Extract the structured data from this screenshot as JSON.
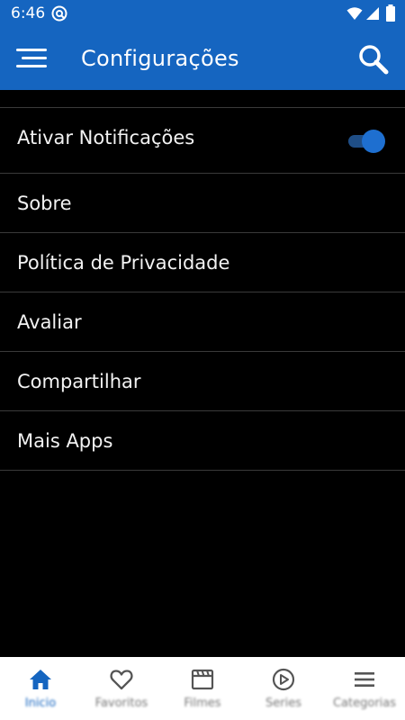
{
  "status_bar": {
    "time": "6:46",
    "icons": [
      "at-sign-icon",
      "wifi-icon",
      "signal-icon",
      "battery-icon"
    ]
  },
  "app_bar": {
    "title": "Configurações",
    "menu_icon": "hamburger-menu-icon",
    "search_icon": "search-icon",
    "background_color": "#1565C0"
  },
  "settings": {
    "items": [
      {
        "label": "Ativar Notificações",
        "toggle": true
      },
      {
        "label": "Sobre"
      },
      {
        "label": "Política de Privacidade"
      },
      {
        "label": "Avaliar"
      },
      {
        "label": "Compartilhar"
      },
      {
        "label": "Mais Apps"
      }
    ]
  },
  "bottom_nav": {
    "items": [
      {
        "label": "Inicio",
        "icon": "home-icon",
        "active": true
      },
      {
        "label": "Favoritos",
        "icon": "heart-icon"
      },
      {
        "label": "Filmes",
        "icon": "clapperboard-icon"
      },
      {
        "label": "Series",
        "icon": "play-circle-icon"
      },
      {
        "label": "Categorias",
        "icon": "menu-lines-icon"
      }
    ],
    "active_color": "#1565C0",
    "inactive_color": "#555555"
  }
}
